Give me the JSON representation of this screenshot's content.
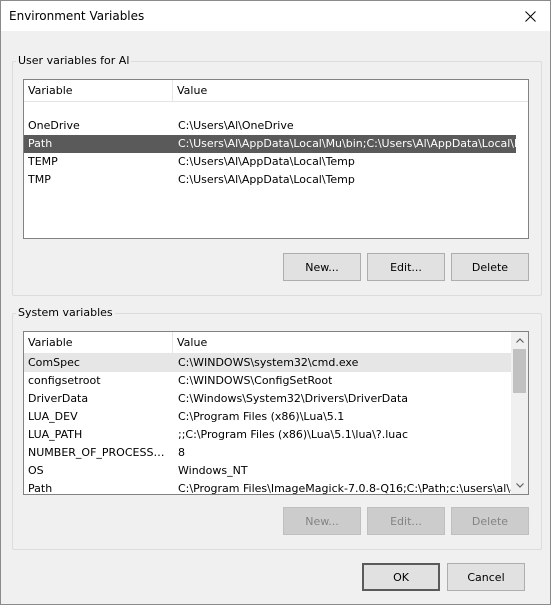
{
  "window": {
    "title": "Environment Variables"
  },
  "user_group": {
    "label": "User variables for Al",
    "columns": [
      "Variable",
      "Value"
    ],
    "rows": [
      {
        "variable": "OneDrive",
        "value": "C:\\Users\\Al\\OneDrive"
      },
      {
        "variable": "Path",
        "value": "C:\\Users\\Al\\AppData\\Local\\Mu\\bin;C:\\Users\\Al\\AppData\\Local\\P..."
      },
      {
        "variable": "TEMP",
        "value": "C:\\Users\\Al\\AppData\\Local\\Temp"
      },
      {
        "variable": "TMP",
        "value": "C:\\Users\\Al\\AppData\\Local\\Temp"
      }
    ],
    "selected_row": 1,
    "buttons": {
      "new": "New...",
      "edit": "Edit...",
      "delete": "Delete"
    }
  },
  "system_group": {
    "label": "System variables",
    "columns": [
      "Variable",
      "Value"
    ],
    "rows": [
      {
        "variable": "ComSpec",
        "value": "C:\\WINDOWS\\system32\\cmd.exe"
      },
      {
        "variable": "configsetroot",
        "value": "C:\\WINDOWS\\ConfigSetRoot"
      },
      {
        "variable": "DriverData",
        "value": "C:\\Windows\\System32\\Drivers\\DriverData"
      },
      {
        "variable": "LUA_DEV",
        "value": "C:\\Program Files (x86)\\Lua\\5.1"
      },
      {
        "variable": "LUA_PATH",
        "value": ";;C:\\Program Files (x86)\\Lua\\5.1\\lua\\?.luac"
      },
      {
        "variable": "NUMBER_OF_PROCESSORS",
        "value": "8"
      },
      {
        "variable": "OS",
        "value": "Windows_NT"
      },
      {
        "variable": "Path",
        "value": "C:\\Program Files\\ImageMagick-7.0.8-Q16;C:\\Path;c:\\users\\al\\app..."
      }
    ],
    "hover_row": 0,
    "buttons": {
      "new": "New...",
      "edit": "Edit...",
      "delete": "Delete"
    }
  },
  "footer": {
    "ok": "OK",
    "cancel": "Cancel"
  }
}
